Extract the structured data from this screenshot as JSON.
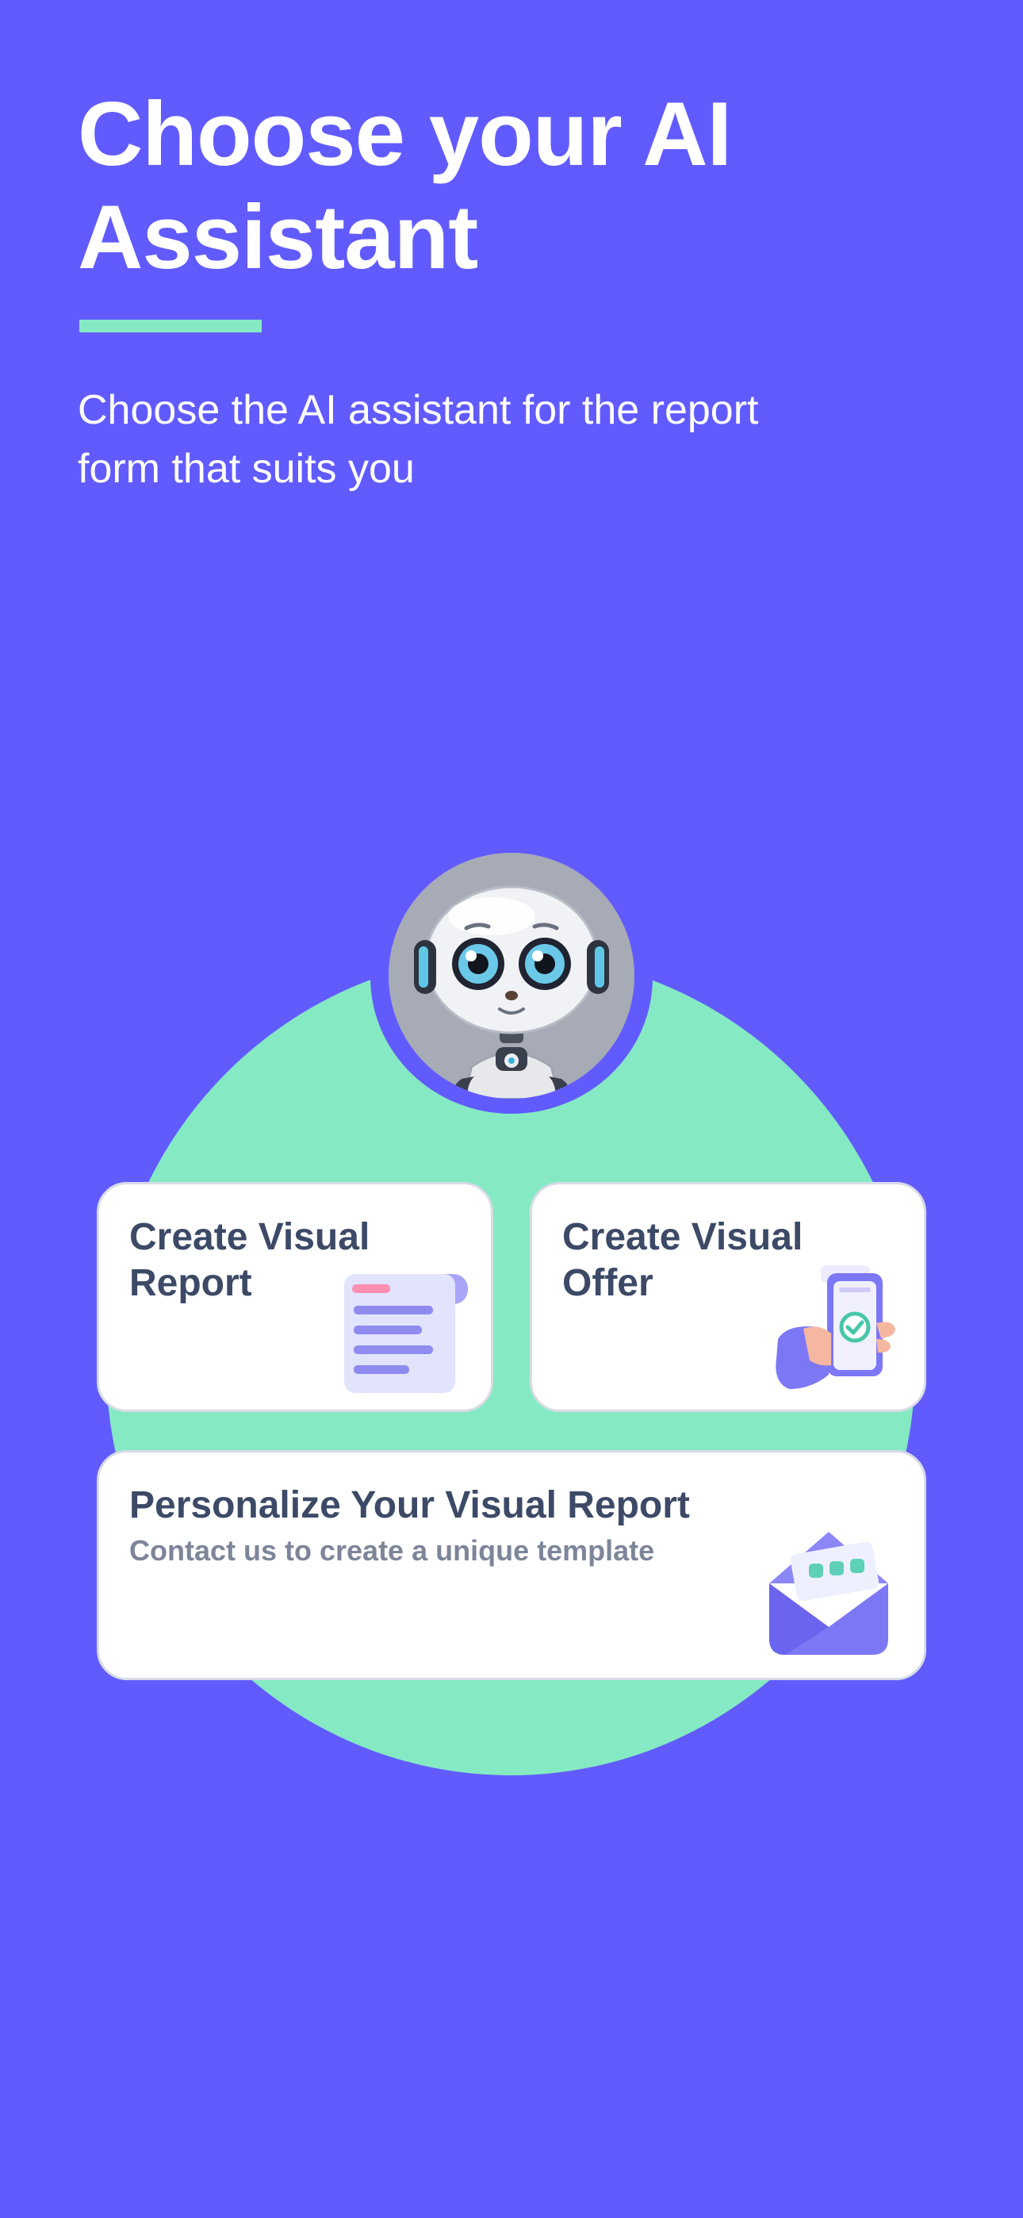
{
  "header": {
    "title_line1": "Choose your AI",
    "title_line2": "Assistant",
    "subtitle_line1": "Choose the AI assistant for the report",
    "subtitle_line2": "form that suits you"
  },
  "avatar": {
    "icon": "robot-icon"
  },
  "cards": {
    "report": {
      "title_line1": "Create Visual",
      "title_line2": "Report",
      "icon": "document-icon"
    },
    "offer": {
      "title_line1": "Create Visual",
      "title_line2": "Offer",
      "icon": "phone-check-icon"
    },
    "personalize": {
      "title": "Personalize Your Visual Report",
      "subtitle": "Contact us to create a unique template",
      "icon": "envelope-icon"
    }
  },
  "colors": {
    "background": "#615BFE",
    "accent": "#85EAC3",
    "card_text": "#3C4A67",
    "card_subtext": "#7D8599"
  }
}
